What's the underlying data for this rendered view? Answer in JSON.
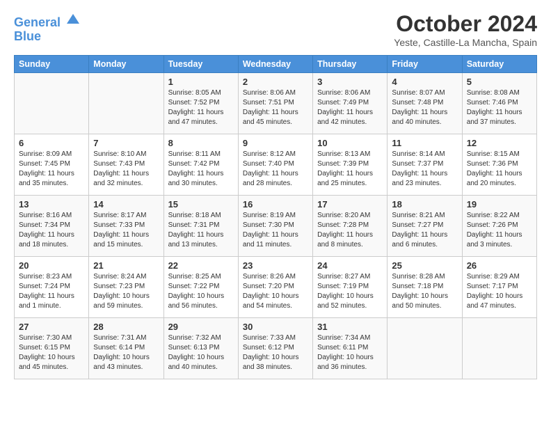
{
  "header": {
    "logo_line1": "General",
    "logo_line2": "Blue",
    "month_title": "October 2024",
    "location": "Yeste, Castille-La Mancha, Spain"
  },
  "weekdays": [
    "Sunday",
    "Monday",
    "Tuesday",
    "Wednesday",
    "Thursday",
    "Friday",
    "Saturday"
  ],
  "weeks": [
    [
      {
        "day": "",
        "info": ""
      },
      {
        "day": "",
        "info": ""
      },
      {
        "day": "1",
        "info": "Sunrise: 8:05 AM\nSunset: 7:52 PM\nDaylight: 11 hours and 47 minutes."
      },
      {
        "day": "2",
        "info": "Sunrise: 8:06 AM\nSunset: 7:51 PM\nDaylight: 11 hours and 45 minutes."
      },
      {
        "day": "3",
        "info": "Sunrise: 8:06 AM\nSunset: 7:49 PM\nDaylight: 11 hours and 42 minutes."
      },
      {
        "day": "4",
        "info": "Sunrise: 8:07 AM\nSunset: 7:48 PM\nDaylight: 11 hours and 40 minutes."
      },
      {
        "day": "5",
        "info": "Sunrise: 8:08 AM\nSunset: 7:46 PM\nDaylight: 11 hours and 37 minutes."
      }
    ],
    [
      {
        "day": "6",
        "info": "Sunrise: 8:09 AM\nSunset: 7:45 PM\nDaylight: 11 hours and 35 minutes."
      },
      {
        "day": "7",
        "info": "Sunrise: 8:10 AM\nSunset: 7:43 PM\nDaylight: 11 hours and 32 minutes."
      },
      {
        "day": "8",
        "info": "Sunrise: 8:11 AM\nSunset: 7:42 PM\nDaylight: 11 hours and 30 minutes."
      },
      {
        "day": "9",
        "info": "Sunrise: 8:12 AM\nSunset: 7:40 PM\nDaylight: 11 hours and 28 minutes."
      },
      {
        "day": "10",
        "info": "Sunrise: 8:13 AM\nSunset: 7:39 PM\nDaylight: 11 hours and 25 minutes."
      },
      {
        "day": "11",
        "info": "Sunrise: 8:14 AM\nSunset: 7:37 PM\nDaylight: 11 hours and 23 minutes."
      },
      {
        "day": "12",
        "info": "Sunrise: 8:15 AM\nSunset: 7:36 PM\nDaylight: 11 hours and 20 minutes."
      }
    ],
    [
      {
        "day": "13",
        "info": "Sunrise: 8:16 AM\nSunset: 7:34 PM\nDaylight: 11 hours and 18 minutes."
      },
      {
        "day": "14",
        "info": "Sunrise: 8:17 AM\nSunset: 7:33 PM\nDaylight: 11 hours and 15 minutes."
      },
      {
        "day": "15",
        "info": "Sunrise: 8:18 AM\nSunset: 7:31 PM\nDaylight: 11 hours and 13 minutes."
      },
      {
        "day": "16",
        "info": "Sunrise: 8:19 AM\nSunset: 7:30 PM\nDaylight: 11 hours and 11 minutes."
      },
      {
        "day": "17",
        "info": "Sunrise: 8:20 AM\nSunset: 7:28 PM\nDaylight: 11 hours and 8 minutes."
      },
      {
        "day": "18",
        "info": "Sunrise: 8:21 AM\nSunset: 7:27 PM\nDaylight: 11 hours and 6 minutes."
      },
      {
        "day": "19",
        "info": "Sunrise: 8:22 AM\nSunset: 7:26 PM\nDaylight: 11 hours and 3 minutes."
      }
    ],
    [
      {
        "day": "20",
        "info": "Sunrise: 8:23 AM\nSunset: 7:24 PM\nDaylight: 11 hours and 1 minute."
      },
      {
        "day": "21",
        "info": "Sunrise: 8:24 AM\nSunset: 7:23 PM\nDaylight: 10 hours and 59 minutes."
      },
      {
        "day": "22",
        "info": "Sunrise: 8:25 AM\nSunset: 7:22 PM\nDaylight: 10 hours and 56 minutes."
      },
      {
        "day": "23",
        "info": "Sunrise: 8:26 AM\nSunset: 7:20 PM\nDaylight: 10 hours and 54 minutes."
      },
      {
        "day": "24",
        "info": "Sunrise: 8:27 AM\nSunset: 7:19 PM\nDaylight: 10 hours and 52 minutes."
      },
      {
        "day": "25",
        "info": "Sunrise: 8:28 AM\nSunset: 7:18 PM\nDaylight: 10 hours and 50 minutes."
      },
      {
        "day": "26",
        "info": "Sunrise: 8:29 AM\nSunset: 7:17 PM\nDaylight: 10 hours and 47 minutes."
      }
    ],
    [
      {
        "day": "27",
        "info": "Sunrise: 7:30 AM\nSunset: 6:15 PM\nDaylight: 10 hours and 45 minutes."
      },
      {
        "day": "28",
        "info": "Sunrise: 7:31 AM\nSunset: 6:14 PM\nDaylight: 10 hours and 43 minutes."
      },
      {
        "day": "29",
        "info": "Sunrise: 7:32 AM\nSunset: 6:13 PM\nDaylight: 10 hours and 40 minutes."
      },
      {
        "day": "30",
        "info": "Sunrise: 7:33 AM\nSunset: 6:12 PM\nDaylight: 10 hours and 38 minutes."
      },
      {
        "day": "31",
        "info": "Sunrise: 7:34 AM\nSunset: 6:11 PM\nDaylight: 10 hours and 36 minutes."
      },
      {
        "day": "",
        "info": ""
      },
      {
        "day": "",
        "info": ""
      }
    ]
  ]
}
